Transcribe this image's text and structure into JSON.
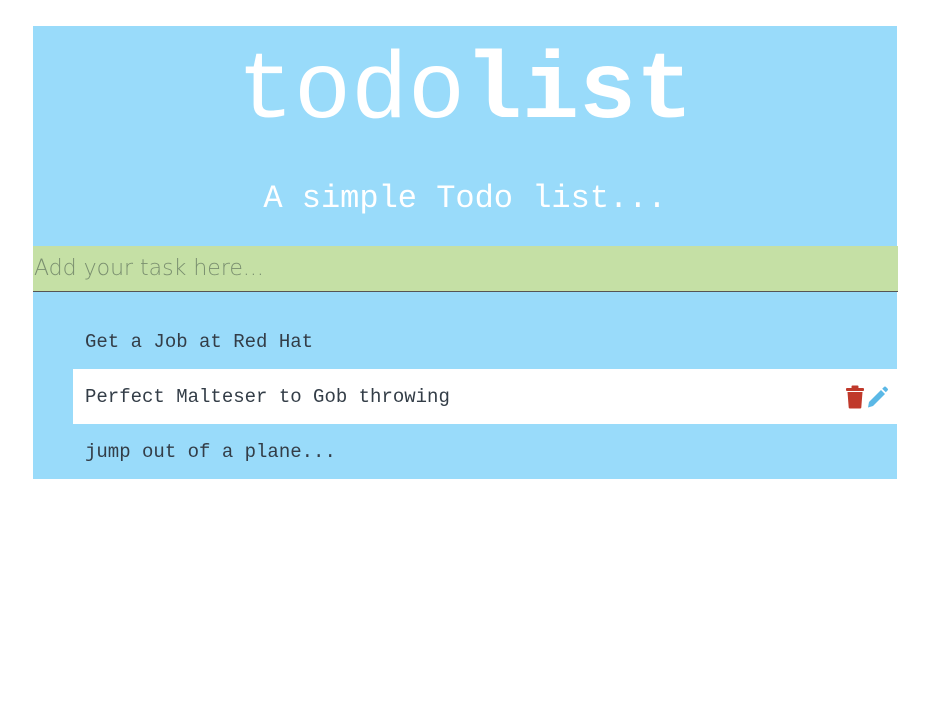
{
  "header": {
    "title_light": "todo",
    "title_bold": "list",
    "subtitle": "A simple Todo list..."
  },
  "input": {
    "placeholder": "Add your task here...",
    "value": ""
  },
  "tasks": [
    {
      "label": "Get a Job at Red Hat"
    },
    {
      "label": "Perfect Malteser to Gob throwing",
      "hovered": true,
      "actions": [
        "trash-icon",
        "pencil-icon"
      ]
    },
    {
      "label": "jump out of a plane..."
    }
  ],
  "colors": {
    "panel": "#99dbfa",
    "input_bg": "#c5e0a5",
    "delete": "#c0392b",
    "edit": "#5bb8e6"
  }
}
